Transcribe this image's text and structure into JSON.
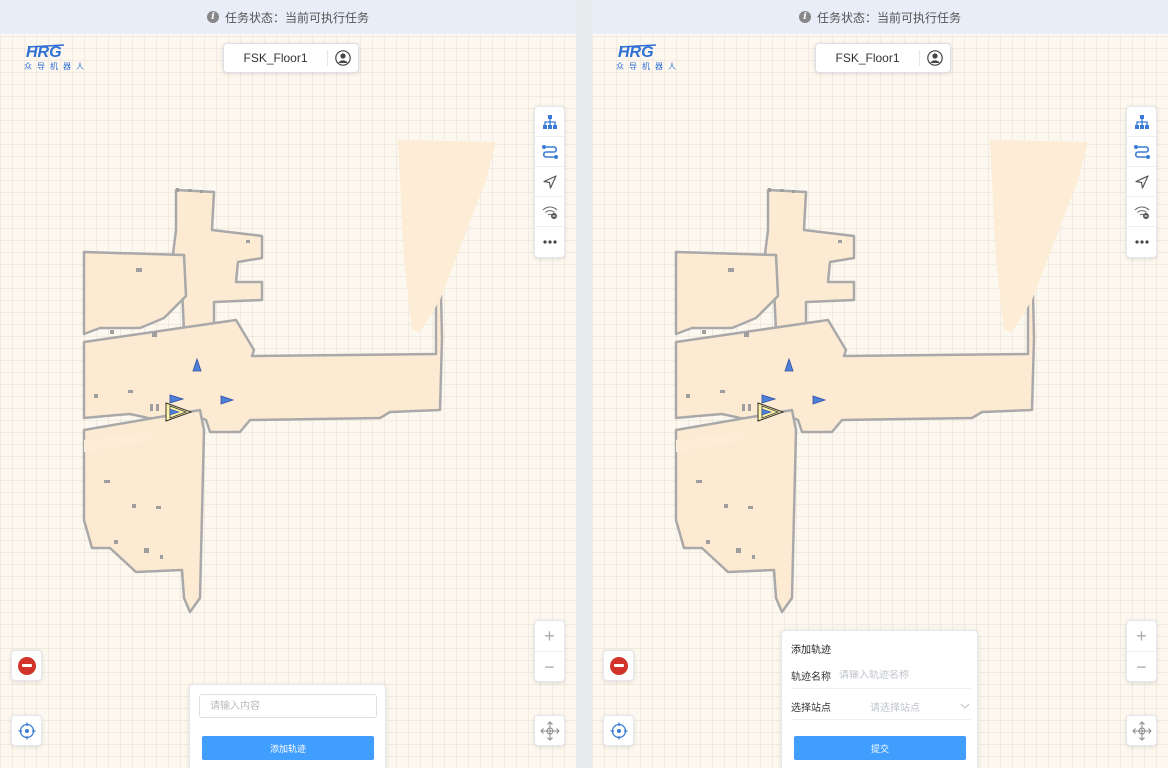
{
  "status_bar": {
    "text": "任务状态：当前可执行任务"
  },
  "logo": {
    "brand_mark": "HRG",
    "subtitle": "众导机器人"
  },
  "floor_selector": {
    "value": "FSK_Floor1"
  },
  "toolbar": {
    "icons": [
      "sitemap-icon",
      "route-icon",
      "navigate-arrow-icon",
      "wifi-signal-icon",
      "more-icon"
    ]
  },
  "zoom": {
    "in_label": "+",
    "out_label": "−"
  },
  "left_panel": {
    "search_placeholder": "请输入内容",
    "add_trajectory_button": "添加轨迹"
  },
  "right_panel": {
    "card_title": "添加轨迹",
    "name_label": "轨迹名称",
    "name_placeholder": "请输入轨迹名称",
    "station_label": "选择站点",
    "station_placeholder": "请选择站点",
    "submit_button": "提交"
  },
  "colors": {
    "accent": "#409eff",
    "brand": "#2f6fd6",
    "stop": "#d2332b",
    "map_floor": "#fdecd6",
    "map_wall": "#a9a9a9"
  }
}
